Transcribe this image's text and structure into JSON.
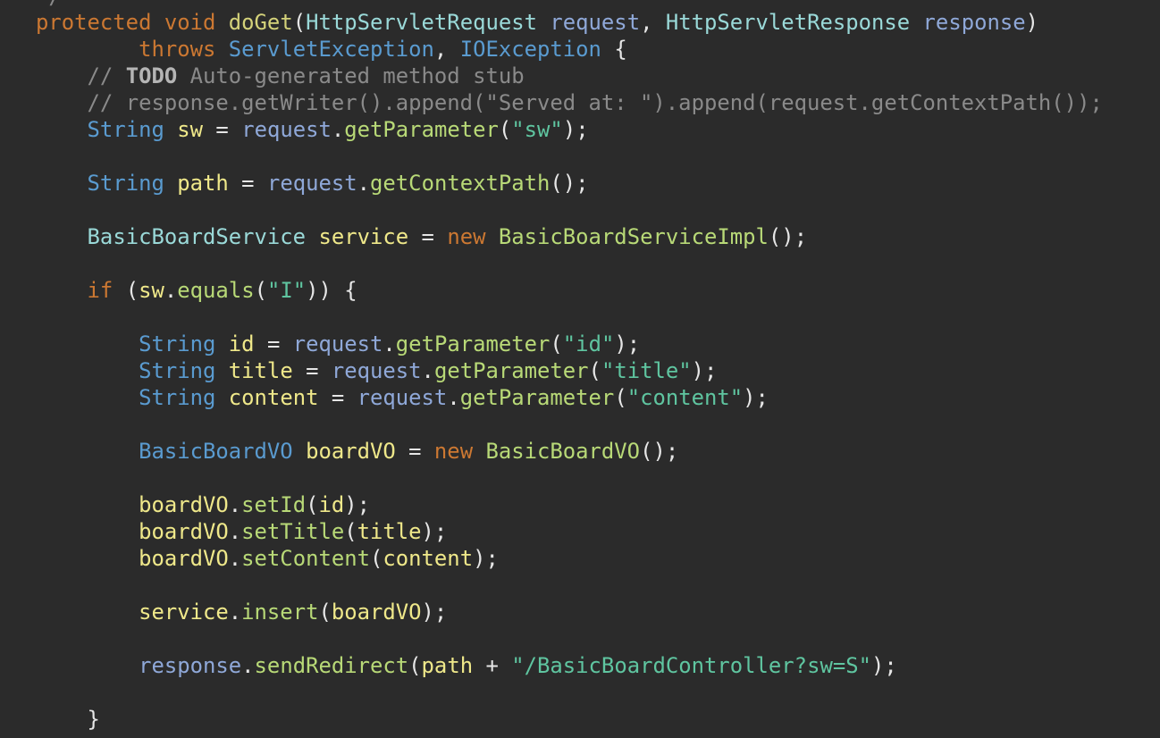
{
  "editor": {
    "background": "#2b2b2b",
    "colors": {
      "keyword": "#cc7832",
      "method": "#d4d27a",
      "type": "#9ad9d8",
      "parameter": "#8fa8d8",
      "local_variable": "#efe88a",
      "string": "#5fc5a0",
      "comment": "#8a8a8a",
      "class": "#5a9bd0",
      "constructor": "#b8d977",
      "plain": "#d4d4d4"
    },
    "lines": [
      {
        "tokens": [
          {
            "t": "kw",
            "v": "protected"
          },
          {
            "t": "plain",
            "v": " "
          },
          {
            "t": "kw",
            "v": "void"
          },
          {
            "t": "plain",
            "v": " "
          },
          {
            "t": "method",
            "v": "doGet"
          },
          {
            "t": "punct",
            "v": "("
          },
          {
            "t": "type",
            "v": "HttpServletRequest"
          },
          {
            "t": "plain",
            "v": " "
          },
          {
            "t": "param",
            "v": "request"
          },
          {
            "t": "punct",
            "v": ", "
          },
          {
            "t": "type",
            "v": "HttpServletResponse"
          },
          {
            "t": "plain",
            "v": " "
          },
          {
            "t": "param",
            "v": "response"
          },
          {
            "t": "punct",
            "v": ")"
          }
        ]
      },
      {
        "tokens": [
          {
            "t": "plain",
            "v": "        "
          },
          {
            "t": "kw",
            "v": "throws"
          },
          {
            "t": "plain",
            "v": " "
          },
          {
            "t": "class",
            "v": "ServletException"
          },
          {
            "t": "punct",
            "v": ", "
          },
          {
            "t": "class",
            "v": "IOException"
          },
          {
            "t": "plain",
            "v": " "
          },
          {
            "t": "punct",
            "v": "{"
          }
        ]
      },
      {
        "tokens": [
          {
            "t": "plain",
            "v": "    "
          },
          {
            "t": "comment",
            "v": "// "
          },
          {
            "t": "todo",
            "v": "TODO"
          },
          {
            "t": "comment",
            "v": " Auto-generated method stub"
          }
        ]
      },
      {
        "tokens": [
          {
            "t": "plain",
            "v": "    "
          },
          {
            "t": "comment",
            "v": "// response.getWriter().append(\"Served at: \").append(request.getContextPath());"
          }
        ]
      },
      {
        "tokens": [
          {
            "t": "plain",
            "v": "    "
          },
          {
            "t": "class",
            "v": "String"
          },
          {
            "t": "plain",
            "v": " "
          },
          {
            "t": "local",
            "v": "sw"
          },
          {
            "t": "punct",
            "v": " = "
          },
          {
            "t": "param",
            "v": "request"
          },
          {
            "t": "punct",
            "v": "."
          },
          {
            "t": "ctor",
            "v": "getParameter"
          },
          {
            "t": "punct",
            "v": "("
          },
          {
            "t": "string",
            "v": "\"sw\""
          },
          {
            "t": "punct",
            "v": ");"
          }
        ]
      },
      {
        "tokens": []
      },
      {
        "tokens": [
          {
            "t": "plain",
            "v": "    "
          },
          {
            "t": "class",
            "v": "String"
          },
          {
            "t": "plain",
            "v": " "
          },
          {
            "t": "local",
            "v": "path"
          },
          {
            "t": "punct",
            "v": " = "
          },
          {
            "t": "param",
            "v": "request"
          },
          {
            "t": "punct",
            "v": "."
          },
          {
            "t": "ctor",
            "v": "getContextPath"
          },
          {
            "t": "punct",
            "v": "();"
          }
        ]
      },
      {
        "tokens": []
      },
      {
        "tokens": [
          {
            "t": "plain",
            "v": "    "
          },
          {
            "t": "type",
            "v": "BasicBoardService"
          },
          {
            "t": "plain",
            "v": " "
          },
          {
            "t": "local",
            "v": "service"
          },
          {
            "t": "punct",
            "v": " = "
          },
          {
            "t": "kw",
            "v": "new"
          },
          {
            "t": "plain",
            "v": " "
          },
          {
            "t": "ctor",
            "v": "BasicBoardServiceImpl"
          },
          {
            "t": "punct",
            "v": "();"
          }
        ]
      },
      {
        "tokens": []
      },
      {
        "tokens": [
          {
            "t": "plain",
            "v": "    "
          },
          {
            "t": "kw",
            "v": "if"
          },
          {
            "t": "plain",
            "v": " "
          },
          {
            "t": "punct",
            "v": "("
          },
          {
            "t": "local",
            "v": "sw"
          },
          {
            "t": "punct",
            "v": "."
          },
          {
            "t": "ctor",
            "v": "equals"
          },
          {
            "t": "punct",
            "v": "("
          },
          {
            "t": "string",
            "v": "\"I\""
          },
          {
            "t": "punct",
            "v": ")) {"
          }
        ]
      },
      {
        "tokens": []
      },
      {
        "tokens": [
          {
            "t": "plain",
            "v": "        "
          },
          {
            "t": "class",
            "v": "String"
          },
          {
            "t": "plain",
            "v": " "
          },
          {
            "t": "local",
            "v": "id"
          },
          {
            "t": "punct",
            "v": " = "
          },
          {
            "t": "param",
            "v": "request"
          },
          {
            "t": "punct",
            "v": "."
          },
          {
            "t": "ctor",
            "v": "getParameter"
          },
          {
            "t": "punct",
            "v": "("
          },
          {
            "t": "string",
            "v": "\"id\""
          },
          {
            "t": "punct",
            "v": ");"
          }
        ]
      },
      {
        "tokens": [
          {
            "t": "plain",
            "v": "        "
          },
          {
            "t": "class",
            "v": "String"
          },
          {
            "t": "plain",
            "v": " "
          },
          {
            "t": "local",
            "v": "title"
          },
          {
            "t": "punct",
            "v": " = "
          },
          {
            "t": "param",
            "v": "request"
          },
          {
            "t": "punct",
            "v": "."
          },
          {
            "t": "ctor",
            "v": "getParameter"
          },
          {
            "t": "punct",
            "v": "("
          },
          {
            "t": "string",
            "v": "\"title\""
          },
          {
            "t": "punct",
            "v": ");"
          }
        ]
      },
      {
        "tokens": [
          {
            "t": "plain",
            "v": "        "
          },
          {
            "t": "class",
            "v": "String"
          },
          {
            "t": "plain",
            "v": " "
          },
          {
            "t": "local",
            "v": "content"
          },
          {
            "t": "punct",
            "v": " = "
          },
          {
            "t": "param",
            "v": "request"
          },
          {
            "t": "punct",
            "v": "."
          },
          {
            "t": "ctor",
            "v": "getParameter"
          },
          {
            "t": "punct",
            "v": "("
          },
          {
            "t": "string",
            "v": "\"content\""
          },
          {
            "t": "punct",
            "v": ");"
          }
        ]
      },
      {
        "tokens": []
      },
      {
        "tokens": [
          {
            "t": "plain",
            "v": "        "
          },
          {
            "t": "class",
            "v": "BasicBoardVO"
          },
          {
            "t": "plain",
            "v": " "
          },
          {
            "t": "local",
            "v": "boardVO"
          },
          {
            "t": "punct",
            "v": " = "
          },
          {
            "t": "kw",
            "v": "new"
          },
          {
            "t": "plain",
            "v": " "
          },
          {
            "t": "ctor",
            "v": "BasicBoardVO"
          },
          {
            "t": "punct",
            "v": "();"
          }
        ]
      },
      {
        "tokens": []
      },
      {
        "tokens": [
          {
            "t": "plain",
            "v": "        "
          },
          {
            "t": "local",
            "v": "boardVO"
          },
          {
            "t": "punct",
            "v": "."
          },
          {
            "t": "ctor",
            "v": "setId"
          },
          {
            "t": "punct",
            "v": "("
          },
          {
            "t": "local",
            "v": "id"
          },
          {
            "t": "punct",
            "v": ");"
          }
        ]
      },
      {
        "tokens": [
          {
            "t": "plain",
            "v": "        "
          },
          {
            "t": "local",
            "v": "boardVO"
          },
          {
            "t": "punct",
            "v": "."
          },
          {
            "t": "ctor",
            "v": "setTitle"
          },
          {
            "t": "punct",
            "v": "("
          },
          {
            "t": "local",
            "v": "title"
          },
          {
            "t": "punct",
            "v": ");"
          }
        ]
      },
      {
        "tokens": [
          {
            "t": "plain",
            "v": "        "
          },
          {
            "t": "local",
            "v": "boardVO"
          },
          {
            "t": "punct",
            "v": "."
          },
          {
            "t": "ctor",
            "v": "setContent"
          },
          {
            "t": "punct",
            "v": "("
          },
          {
            "t": "local",
            "v": "content"
          },
          {
            "t": "punct",
            "v": ");"
          }
        ]
      },
      {
        "tokens": []
      },
      {
        "tokens": [
          {
            "t": "plain",
            "v": "        "
          },
          {
            "t": "local",
            "v": "service"
          },
          {
            "t": "punct",
            "v": "."
          },
          {
            "t": "ctor",
            "v": "insert"
          },
          {
            "t": "punct",
            "v": "("
          },
          {
            "t": "local",
            "v": "boardVO"
          },
          {
            "t": "punct",
            "v": ");"
          }
        ]
      },
      {
        "tokens": []
      },
      {
        "tokens": [
          {
            "t": "plain",
            "v": "        "
          },
          {
            "t": "param",
            "v": "response"
          },
          {
            "t": "punct",
            "v": "."
          },
          {
            "t": "ctor",
            "v": "sendRedirect"
          },
          {
            "t": "punct",
            "v": "("
          },
          {
            "t": "local",
            "v": "path"
          },
          {
            "t": "punct",
            "v": " + "
          },
          {
            "t": "string",
            "v": "\"/BasicBoardController?sw=S\""
          },
          {
            "t": "punct",
            "v": ");"
          }
        ]
      },
      {
        "tokens": []
      },
      {
        "tokens": [
          {
            "t": "plain",
            "v": "    "
          },
          {
            "t": "punct",
            "v": "}"
          }
        ]
      }
    ]
  }
}
